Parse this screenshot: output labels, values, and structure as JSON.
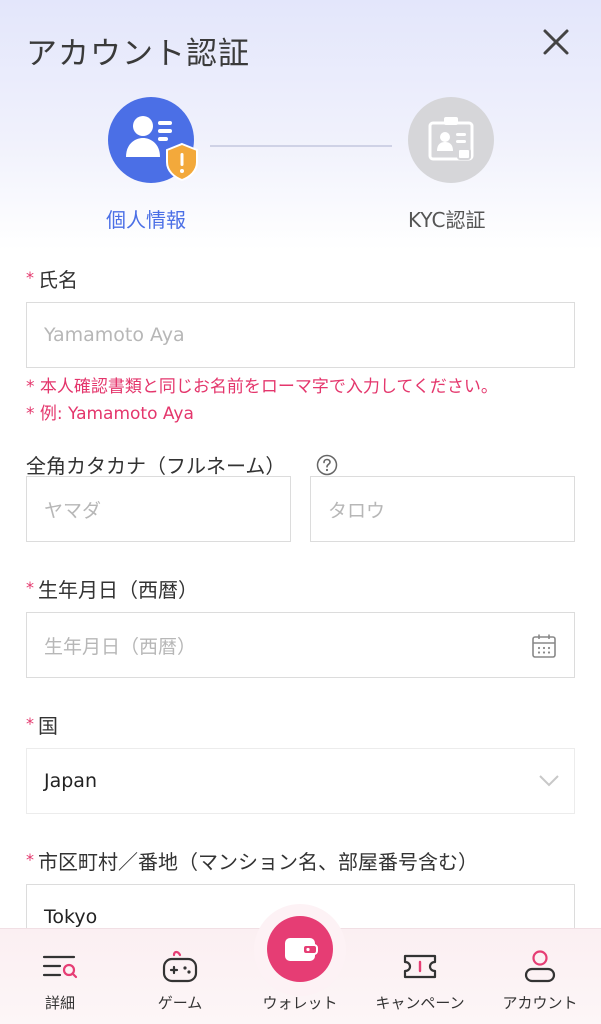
{
  "header": {
    "title": "アカウント認証"
  },
  "stepper": {
    "step1_label": "個人情報",
    "step2_label": "KYC認証"
  },
  "form": {
    "name": {
      "label": "氏名",
      "placeholder": "Yamamoto Aya",
      "hint1": "* 本人確認書類と同じお名前をローマ字で入力してください。",
      "hint2": "* 例: Yamamoto Aya"
    },
    "katakana": {
      "label": "全角カタカナ（フルネーム）",
      "last_placeholder": "ヤマダ",
      "first_placeholder": "タロウ"
    },
    "birthdate": {
      "label": "生年月日（西暦）",
      "placeholder": "生年月日（西暦）"
    },
    "country": {
      "label": "国",
      "value": "Japan"
    },
    "address": {
      "label": "市区町村／番地（マンション名、部屋番号含む）",
      "value": "Tokyo"
    },
    "required_mark": "*"
  },
  "nav": {
    "details": "詳細",
    "games": "ゲーム",
    "wallet": "ウォレット",
    "campaign": "キャンペーン",
    "account": "アカウント"
  },
  "colors": {
    "primary": "#4b6fe6",
    "accent": "#e63d74",
    "required": "#e4366c"
  }
}
